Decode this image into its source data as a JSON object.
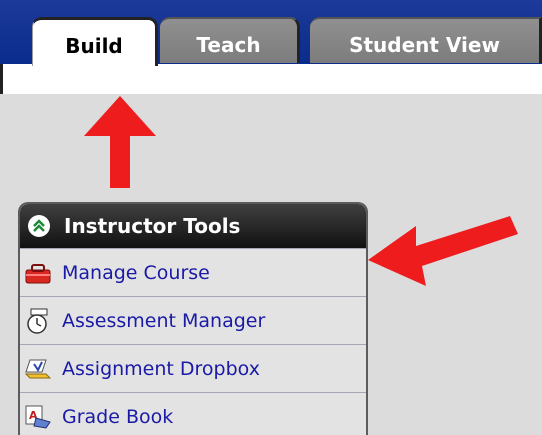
{
  "tabs": [
    {
      "label": "Build",
      "active": true
    },
    {
      "label": "Teach",
      "active": false
    },
    {
      "label": "Student View",
      "active": false
    }
  ],
  "instructor_tools": {
    "title": "Instructor Tools",
    "items": [
      {
        "label": "Manage Course",
        "icon": "toolbox-icon"
      },
      {
        "label": "Assessment Manager",
        "icon": "stopwatch-icon"
      },
      {
        "label": "Assignment Dropbox",
        "icon": "dropbox-icon"
      },
      {
        "label": "Grade Book",
        "icon": "gradebook-icon"
      }
    ]
  },
  "colors": {
    "tab_bar": "#0a2c8c",
    "arrow": "#ee1c1c",
    "link": "#1a1aa6",
    "panel_header": "#1a1a1a"
  }
}
